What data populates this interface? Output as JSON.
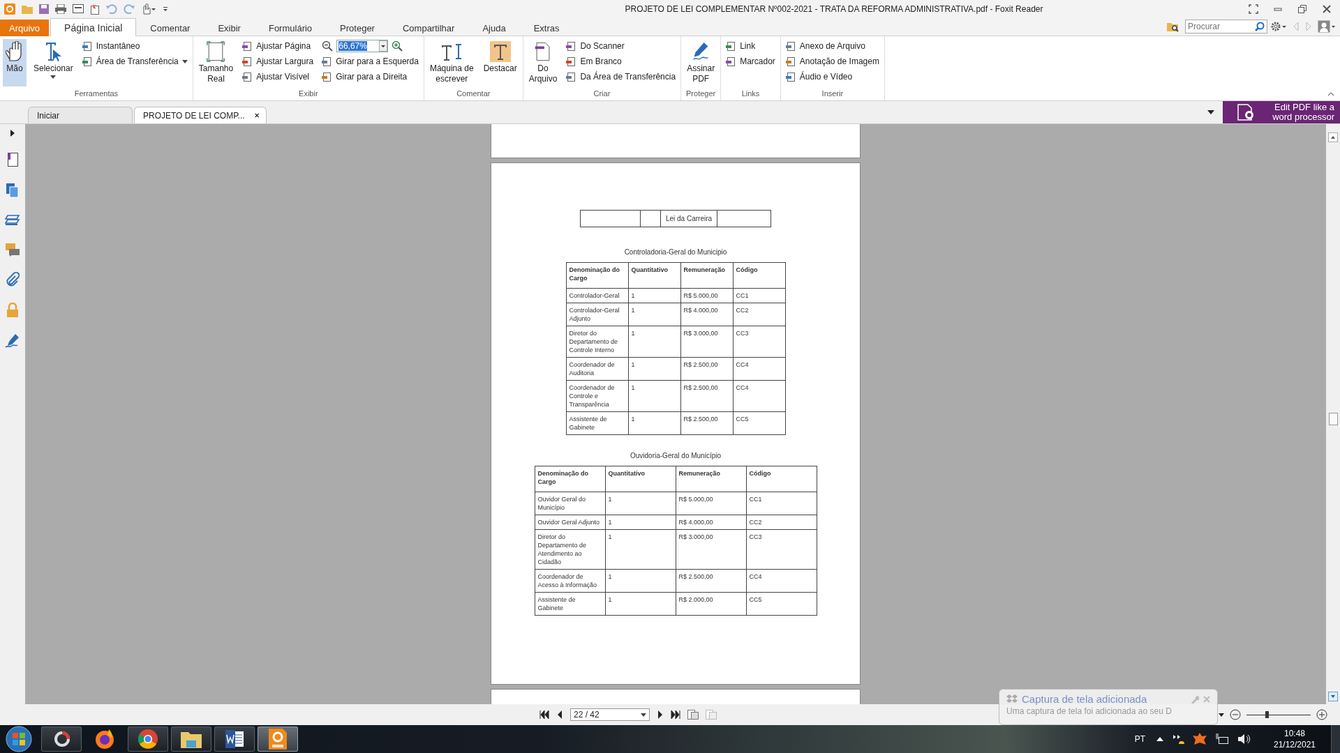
{
  "window": {
    "title": "PROJETO DE LEI COMPLEMENTAR Nº002-2021 - TRATA DA REFORMA ADMINISTRATIVA.pdf - Foxit Reader"
  },
  "menu_tabs": [
    {
      "label": "Arquivo",
      "kind": "file",
      "selected": false
    },
    {
      "label": "Página Inicial",
      "kind": "tab",
      "selected": true
    },
    {
      "label": "Comentar",
      "kind": "tab",
      "selected": false
    },
    {
      "label": "Exibir",
      "kind": "tab",
      "selected": false
    },
    {
      "label": "Formulário",
      "kind": "tab",
      "selected": false
    },
    {
      "label": "Proteger",
      "kind": "tab",
      "selected": false
    },
    {
      "label": "Compartilhar",
      "kind": "tab",
      "selected": false
    },
    {
      "label": "Ajuda",
      "kind": "tab",
      "selected": false
    },
    {
      "label": "Extras",
      "kind": "tab",
      "selected": false
    }
  ],
  "search": {
    "placeholder": "Procurar"
  },
  "ribbon": {
    "groups": [
      {
        "label": "Ferramentas",
        "columns": [
          [
            {
              "kind": "large",
              "label": "Mão",
              "selected": true
            }
          ],
          [
            {
              "kind": "large",
              "label": "Selecionar",
              "selected": false,
              "dropdown": true
            }
          ],
          [
            {
              "kind": "small",
              "label": "Instantâneo"
            },
            {
              "kind": "small",
              "label": "Área de Transferência",
              "dropdown": true
            }
          ]
        ]
      },
      {
        "label": "Exibir",
        "columns": [
          [
            {
              "kind": "large",
              "label": "Tamanho\nReal",
              "selected": false
            }
          ],
          [
            {
              "kind": "small",
              "label": "Ajustar Página"
            },
            {
              "kind": "small",
              "label": "Ajustar Largura"
            },
            {
              "kind": "small",
              "label": "Ajustar Visível"
            }
          ],
          [
            {
              "kind": "zoom",
              "value": "66,67%"
            },
            {
              "kind": "small",
              "label": "Girar para a Esquerda"
            },
            {
              "kind": "small",
              "label": "Girar para a Direita"
            }
          ]
        ]
      },
      {
        "label": "Comentar",
        "columns": [
          [
            {
              "kind": "large",
              "label": "Máquina de\nescrever",
              "selected": false
            }
          ],
          [
            {
              "kind": "large",
              "label": "Destacar",
              "selected": false
            }
          ]
        ]
      },
      {
        "label": "Criar",
        "columns": [
          [
            {
              "kind": "large",
              "label": "Do\nArquivo",
              "selected": false
            }
          ],
          [
            {
              "kind": "small",
              "label": "Do Scanner"
            },
            {
              "kind": "small",
              "label": "Em Branco"
            },
            {
              "kind": "small",
              "label": "Da Área de Transferência"
            }
          ]
        ]
      },
      {
        "label": "Proteger",
        "columns": [
          [
            {
              "kind": "large",
              "label": "Assinar\nPDF",
              "selected": false
            }
          ]
        ]
      },
      {
        "label": "Links",
        "columns": [
          [
            {
              "kind": "small",
              "label": "Link"
            },
            {
              "kind": "small",
              "label": "Marcador"
            }
          ]
        ]
      },
      {
        "label": "Inserir",
        "columns": [
          [
            {
              "kind": "small",
              "label": "Anexo de Arquivo"
            },
            {
              "kind": "small",
              "label": "Anotação de Imagem"
            },
            {
              "kind": "small",
              "label": "Áudio e Vídeo"
            }
          ]
        ]
      }
    ]
  },
  "doc_tabs": [
    {
      "label": "Iniciar",
      "selected": false,
      "closable": false
    },
    {
      "label": "PROJETO DE LEI COMP...",
      "selected": true,
      "closable": true
    }
  ],
  "promo": {
    "label": "Edit PDF like a word processor"
  },
  "document": {
    "header_label": "Lei da Carreira",
    "tables": [
      {
        "caption": "Controladoria-Geral do Municipio",
        "columns": [
          "Denominação do Cargo",
          "Quantitativo",
          "Remuneração",
          "Código"
        ],
        "rows": [
          [
            "Controlador-Geral",
            "1",
            "R$ 5.000,00",
            "CC1"
          ],
          [
            "Controlador-Geral Adjunto",
            "1",
            "R$ 4.000,00",
            "CC2"
          ],
          [
            "Diretor do Departamento de Controle Interno",
            "1",
            "R$ 3.000,00",
            "CC3"
          ],
          [
            "Coordenador de Auditoria",
            "1",
            "R$ 2.500,00",
            "CC4"
          ],
          [
            "Coordenador de Controle e Transparência",
            "1",
            "R$ 2.500,00",
            "CC4"
          ],
          [
            "Assistente de Gabinete",
            "1",
            "R$ 2.500,00",
            "CC5"
          ]
        ]
      },
      {
        "caption": "Ouvidoria-Geral do Município",
        "columns": [
          "Denominação do Cargo",
          "Quantitativo",
          "Remuneração",
          "Código"
        ],
        "rows": [
          [
            "Ouvidor Geral do Município",
            "1",
            "R$ 5.000,00",
            "CC1"
          ],
          [
            "Ouvidor Geral Adjunto",
            "1",
            "R$ 4.000,00",
            "CC2"
          ],
          [
            "Diretor do Departamento de Atendimento ao Cidadão",
            "1",
            "R$ 3.000,00",
            "CC3"
          ],
          [
            "Coordenador de Acesso à Informação",
            "1",
            "R$ 2.500,00",
            "CC4"
          ],
          [
            "Assistente de Gabinete",
            "1",
            "R$ 2.000,00",
            "CC5"
          ]
        ]
      }
    ]
  },
  "status_bar": {
    "page": "22 / 42",
    "zoom_slider": {
      "level": 0.31
    }
  },
  "notification": {
    "title": "Captura de tela adicionada",
    "message": "Uma captura de tela foi adicionada ao seu D"
  },
  "taskbar": {
    "apps": [
      {
        "running": true,
        "selected": false
      },
      {
        "running": false,
        "selected": false
      },
      {
        "running": true,
        "selected": false
      },
      {
        "running": true,
        "selected": false
      },
      {
        "running": true,
        "selected": false
      },
      {
        "running": true,
        "selected": true
      }
    ],
    "language": "PT",
    "time": "10:48",
    "date": "21/12/2021"
  }
}
